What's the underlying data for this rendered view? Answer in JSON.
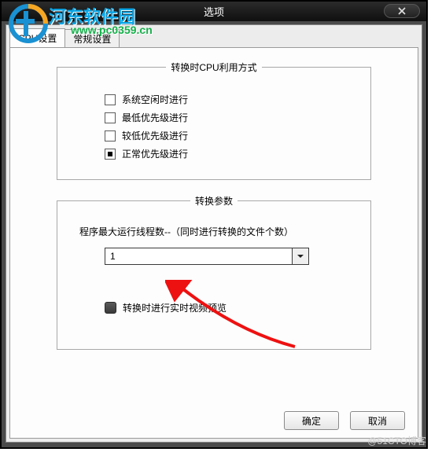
{
  "window": {
    "title": "选项"
  },
  "tabs": {
    "cpu": "CPU设置",
    "general": "常规设置"
  },
  "group_cpu": {
    "legend": "转换时CPU利用方式",
    "opt_idle": "系统空闲时进行",
    "opt_lowest": "最低优先级进行",
    "opt_lower": "较低优先级进行",
    "opt_normal": "正常优先级进行"
  },
  "group_params": {
    "legend": "转换参数",
    "desc": "程序最大运行线程数--（同时进行转换的文件个数）",
    "thread_value": "1",
    "preview": "转换时进行实时视频预览"
  },
  "footer": {
    "ok": "确定",
    "cancel": "取消"
  },
  "watermark": {
    "brand": "河东软件园",
    "url": "www.pc0359.cn",
    "cto": "@51CTO博客"
  }
}
